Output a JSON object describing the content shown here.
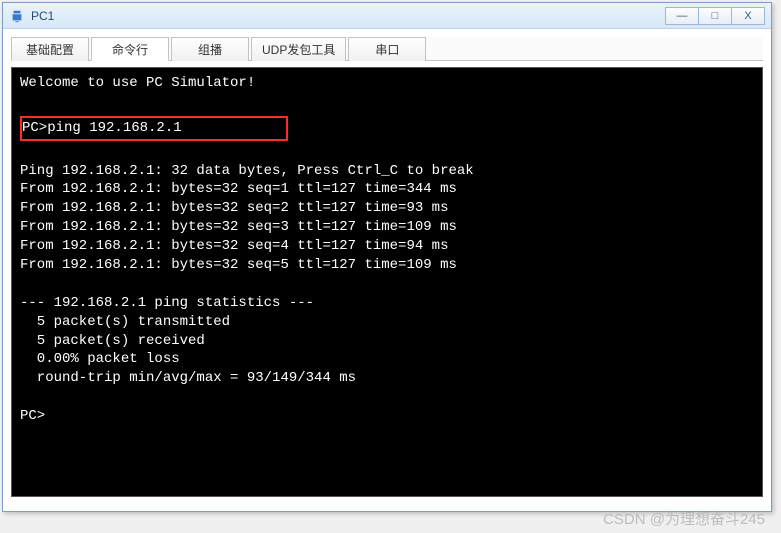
{
  "window": {
    "title": "PC1",
    "buttons": {
      "min": "—",
      "max": "□",
      "close": "X"
    }
  },
  "tabs": [
    {
      "label": "基础配置",
      "active": false
    },
    {
      "label": "命令行",
      "active": true
    },
    {
      "label": "组播",
      "active": false
    },
    {
      "label": "UDP发包工具",
      "active": false
    },
    {
      "label": "串口",
      "active": false
    }
  ],
  "terminal": {
    "welcome": "Welcome to use PC Simulator!",
    "prompt": "PC>",
    "command": "ping 192.168.2.1",
    "blank1": "",
    "header": "Ping 192.168.2.1: 32 data bytes, Press Ctrl_C to break",
    "replies": [
      "From 192.168.2.1: bytes=32 seq=1 ttl=127 time=344 ms",
      "From 192.168.2.1: bytes=32 seq=2 ttl=127 time=93 ms",
      "From 192.168.2.1: bytes=32 seq=3 ttl=127 time=109 ms",
      "From 192.168.2.1: bytes=32 seq=4 ttl=127 time=94 ms",
      "From 192.168.2.1: bytes=32 seq=5 ttl=127 time=109 ms"
    ],
    "blank2": "",
    "stats_header": "--- 192.168.2.1 ping statistics ---",
    "stats": [
      "  5 packet(s) transmitted",
      "  5 packet(s) received",
      "  0.00% packet loss",
      "  round-trip min/avg/max = 93/149/344 ms"
    ],
    "blank3": "",
    "prompt2": "PC>"
  },
  "watermark": "CSDN @为理想奋斗245"
}
